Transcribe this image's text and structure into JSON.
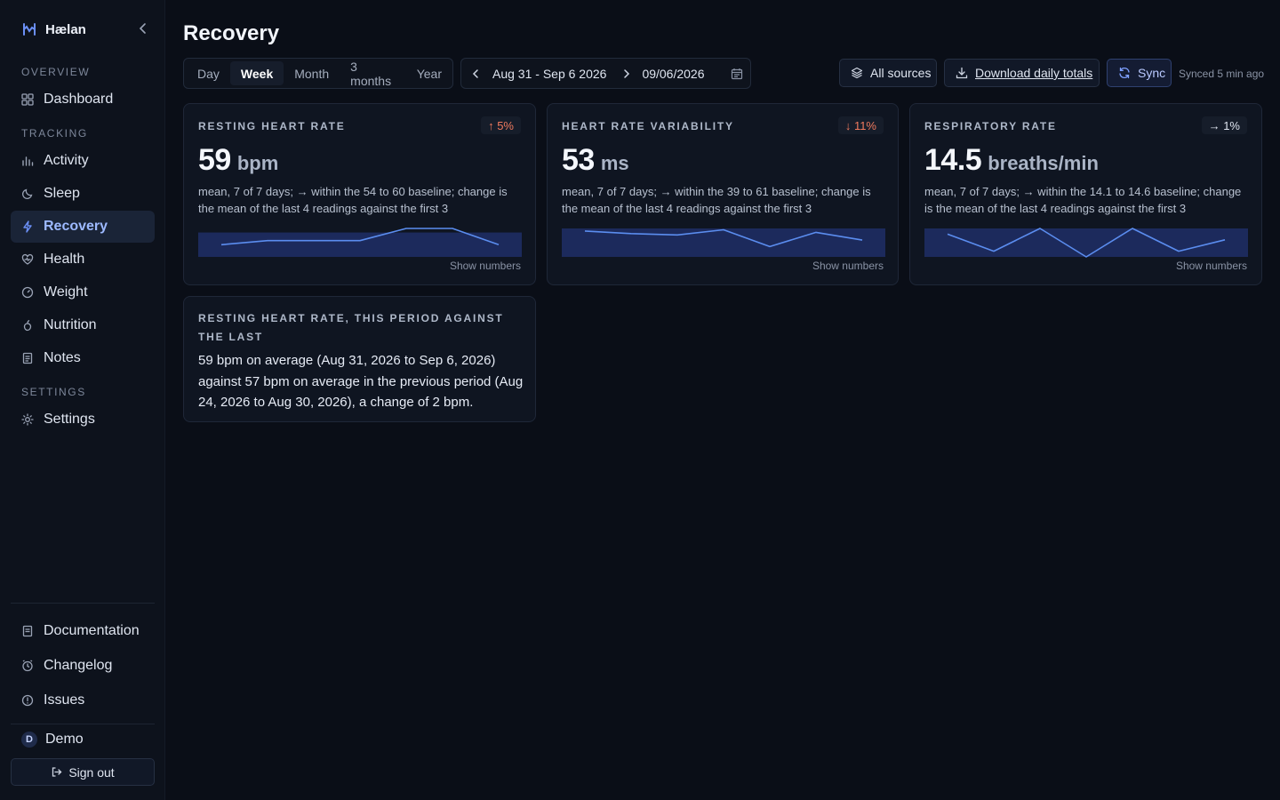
{
  "app": {
    "name": "Hælan"
  },
  "sidebar": {
    "sections": {
      "overview": "Overview",
      "tracking": "Tracking",
      "settings": "Settings"
    },
    "items": {
      "dashboard": "Dashboard",
      "activity": "Activity",
      "sleep": "Sleep",
      "recovery": "Recovery",
      "health": "Health",
      "weight": "Weight",
      "nutrition": "Nutrition",
      "notes": "Notes",
      "settings": "Settings"
    },
    "footer": {
      "documentation": "Documentation",
      "changelog": "Changelog",
      "issues": "Issues"
    },
    "user": {
      "initial": "D",
      "name": "Demo"
    },
    "signout": "Sign out"
  },
  "header": {
    "title": "Recovery",
    "periods": [
      "Day",
      "Week",
      "Month",
      "3 months",
      "Year"
    ],
    "active_period": "Week",
    "date_range": "Aug 31 - Sep 6 2026",
    "date_input": "09/06/2026",
    "sources_label": "All sources",
    "download_label": "Download daily totals",
    "sync_label": "Sync",
    "synced_status": "Synced 5 min ago"
  },
  "cards": [
    {
      "title": "Resting heart rate",
      "badge": "↑ 5%",
      "badge_color": "#f07a5e",
      "value": "59",
      "unit": "bpm",
      "description": "mean, 7 of 7 days; → within the 54 to 60 baseline; change is the mean of the last 4 readings against the first 3",
      "show_numbers": "Show numbers",
      "series": [
        57,
        58,
        58,
        58,
        61,
        61,
        57
      ],
      "baseline": [
        54,
        60
      ]
    },
    {
      "title": "Heart rate variability",
      "badge": "↓ 11%",
      "badge_color": "#f07a5e",
      "value": "53",
      "unit": "ms",
      "description": "mean, 7 of 7 days; → within the 39 to 61 baseline; change is the mean of the last 4 readings against the first 3",
      "show_numbers": "Show numbers",
      "series": [
        59,
        57,
        56,
        60,
        47,
        58,
        52
      ],
      "baseline": [
        39,
        61
      ]
    },
    {
      "title": "Respiratory rate",
      "badge": "→ 1%",
      "badge_color": "#dfe5f0",
      "value": "14.5",
      "unit": "breaths/min",
      "description": "mean, 7 of 7 days; → within the 14.1 to 14.6 baseline; change is the mean of the last 4 readings against the first 3",
      "show_numbers": "Show numbers",
      "series": [
        14.5,
        14.2,
        14.6,
        14.1,
        14.6,
        14.2,
        14.4
      ],
      "baseline": [
        14.1,
        14.6
      ]
    }
  ],
  "comparison": {
    "title": "Resting heart rate, this period against the last",
    "text": "59 bpm on average (Aug 31, 2026 to Sep 6, 2026) against 57 bpm on average in the previous period (Aug 24, 2026 to Aug 30, 2026), a change of 2 bpm."
  },
  "colors": {
    "accent": "#5b8def",
    "baseline_band": "#1c2a5c",
    "warning": "#f07a5e"
  }
}
